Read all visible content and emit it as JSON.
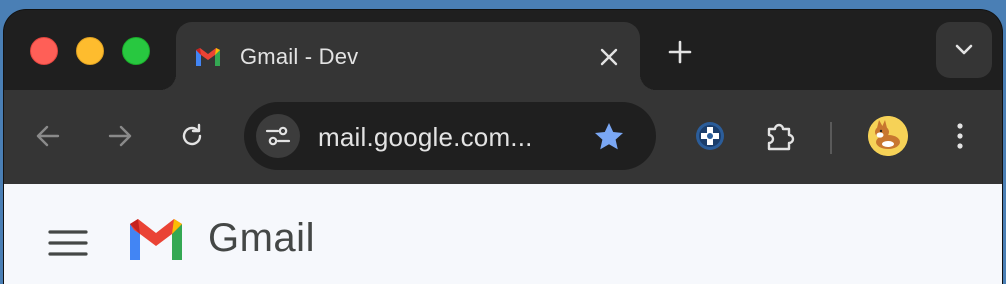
{
  "window": {
    "controls": {
      "close": "close",
      "minimize": "minimize",
      "zoom": "zoom"
    }
  },
  "tab": {
    "title": "Gmail - Dev",
    "favicon_icon": "gmail-m-icon",
    "close_icon": "close-icon"
  },
  "tabstrip": {
    "new_tab_icon": "plus-icon",
    "tab_search_icon": "chevron-down-icon"
  },
  "toolbar": {
    "back_icon": "arrow-left-icon",
    "forward_icon": "arrow-right-icon",
    "reload_icon": "reload-icon",
    "site_info_icon": "tune-icon",
    "url": "mail.google.com...",
    "bookmark_icon": "star-icon",
    "extension_icon": "shield-cross-icon",
    "extensions_menu_icon": "puzzle-icon",
    "menu_icon": "kebab-menu-icon"
  },
  "gmail": {
    "menu_icon": "hamburger-icon",
    "logo_icon": "gmail-logo-icon",
    "brand": "Gmail"
  },
  "colors": {
    "desktop": "#4a7fb5",
    "tabstrip_bg": "#1f1f1f",
    "toolbar_bg": "#353535",
    "star": "#7aa7f4",
    "content_bg": "#f6f8fc"
  }
}
